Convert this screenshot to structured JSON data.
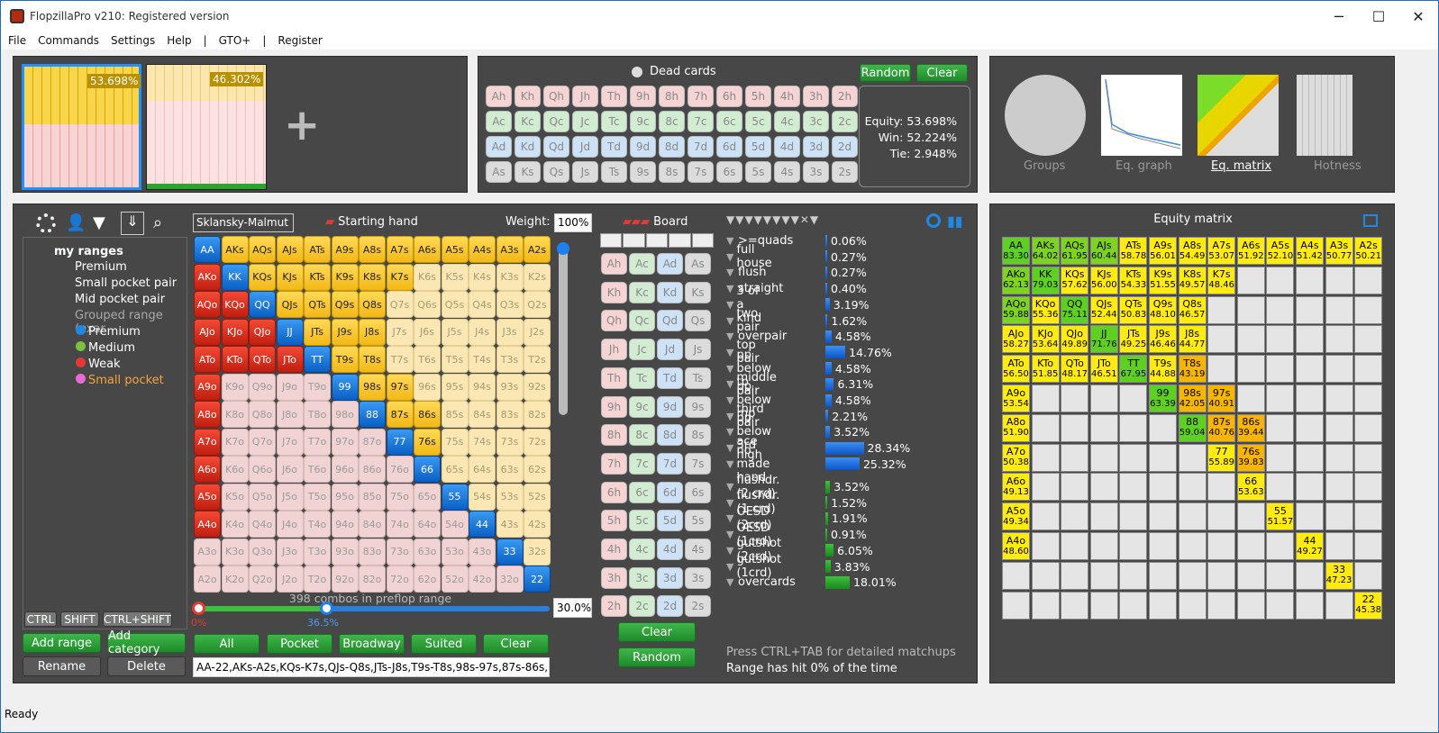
{
  "window": {
    "title": "FlopzillaPro v210: Registered version",
    "minimize": "─",
    "maximize": "☐",
    "close": "✕"
  },
  "menu": [
    "File",
    "Commands",
    "Settings",
    "Help",
    "|",
    "GTO+",
    "|",
    "Register"
  ],
  "ranges_top": {
    "pct1": "53.698%",
    "pct2": "46.302%",
    "add": "+"
  },
  "dead": {
    "title": "Dead cards",
    "random": "Random",
    "clear": "Clear",
    "rows": [
      [
        "Ah",
        "Kh",
        "Qh",
        "Jh",
        "Th",
        "9h",
        "8h",
        "7h",
        "6h",
        "5h",
        "4h",
        "3h",
        "2h"
      ],
      [
        "Ac",
        "Kc",
        "Qc",
        "Jc",
        "Tc",
        "9c",
        "8c",
        "7c",
        "6c",
        "5c",
        "4c",
        "3c",
        "2c"
      ],
      [
        "Ad",
        "Kd",
        "Qd",
        "Jd",
        "Td",
        "9d",
        "8d",
        "7d",
        "6d",
        "5d",
        "4d",
        "3d",
        "2d"
      ],
      [
        "As",
        "Ks",
        "Qs",
        "Js",
        "Ts",
        "9s",
        "8s",
        "7s",
        "6s",
        "5s",
        "4s",
        "3s",
        "2s"
      ]
    ],
    "equity": "Equity: 53.698%",
    "win": "Win: 52.224%",
    "tie": "Tie: 2.948%"
  },
  "tabs": [
    "Groups",
    "Eq. graph",
    "Eq. matrix",
    "Hotness"
  ],
  "tree": {
    "root": "my ranges",
    "items": [
      "Premium",
      "Small pocket pair",
      "Mid pocket pair"
    ],
    "group": "Grouped range (exar",
    "sub": [
      "Premium",
      "Medium",
      "Weak",
      "Small pocket"
    ],
    "sub_colors": [
      "#1e88e5",
      "#7bc142",
      "#e53935",
      "#e86ad7"
    ]
  },
  "modifiers": [
    "CTRL",
    "SHIFT",
    "CTRL+SHIFT"
  ],
  "left_buttons": [
    "Add range",
    "Add category",
    "Rename",
    "Delete"
  ],
  "grid": {
    "preset": "Sklansky-Malmut",
    "starting_hand": "Starting hand",
    "weight_label": "Weight:",
    "weight": "100%",
    "combos": "398 combos in preflop range",
    "pct": "30.0%",
    "slider_min": "0%",
    "slider_val": "36.5%",
    "rows": [
      [
        "AA",
        "AKs",
        "AQs",
        "AJs",
        "ATs",
        "A9s",
        "A8s",
        "A7s",
        "A6s",
        "A5s",
        "A4s",
        "A3s",
        "A2s"
      ],
      [
        "AKo",
        "KK",
        "KQs",
        "KJs",
        "KTs",
        "K9s",
        "K8s",
        "K7s",
        "K6s",
        "K5s",
        "K4s",
        "K3s",
        "K2s"
      ],
      [
        "AQo",
        "KQo",
        "QQ",
        "QJs",
        "QTs",
        "Q9s",
        "Q8s",
        "Q7s",
        "Q6s",
        "Q5s",
        "Q4s",
        "Q3s",
        "Q2s"
      ],
      [
        "AJo",
        "KJo",
        "QJo",
        "JJ",
        "JTs",
        "J9s",
        "J8s",
        "J7s",
        "J6s",
        "J5s",
        "J4s",
        "J3s",
        "J2s"
      ],
      [
        "ATo",
        "KTo",
        "QTo",
        "JTo",
        "TT",
        "T9s",
        "T8s",
        "T7s",
        "T6s",
        "T5s",
        "T4s",
        "T3s",
        "T2s"
      ],
      [
        "A9o",
        "K9o",
        "Q9o",
        "J9o",
        "T9o",
        "99",
        "98s",
        "97s",
        "96s",
        "95s",
        "94s",
        "93s",
        "92s"
      ],
      [
        "A8o",
        "K8o",
        "Q8o",
        "J8o",
        "T8o",
        "98o",
        "88",
        "87s",
        "86s",
        "85s",
        "84s",
        "83s",
        "82s"
      ],
      [
        "A7o",
        "K7o",
        "Q7o",
        "J7o",
        "T7o",
        "97o",
        "87o",
        "77",
        "76s",
        "75s",
        "74s",
        "73s",
        "72s"
      ],
      [
        "A6o",
        "K6o",
        "Q6o",
        "J6o",
        "T6o",
        "96o",
        "86o",
        "76o",
        "66",
        "65s",
        "64s",
        "63s",
        "62s"
      ],
      [
        "A5o",
        "K5o",
        "Q5o",
        "J5o",
        "T5o",
        "95o",
        "85o",
        "75o",
        "65o",
        "55",
        "54s",
        "53s",
        "52s"
      ],
      [
        "A4o",
        "K4o",
        "Q4o",
        "J4o",
        "T4o",
        "94o",
        "84o",
        "74o",
        "64o",
        "54o",
        "44",
        "43s",
        "42s"
      ],
      [
        "A3o",
        "K3o",
        "Q3o",
        "J3o",
        "T3o",
        "93o",
        "83o",
        "73o",
        "63o",
        "53o",
        "43o",
        "33",
        "32s"
      ],
      [
        "A2o",
        "K2o",
        "Q2o",
        "J2o",
        "T2o",
        "92o",
        "82o",
        "72o",
        "62o",
        "52o",
        "42o",
        "32o",
        "22"
      ]
    ],
    "buttons": [
      "All",
      "Pocket",
      "Broadway",
      "Suited",
      "Clear"
    ],
    "range_text": "AA-22,AKs-A2s,KQs-K7s,QJs-Q8s,JTs-J8s,T9s-T8s,98s-97s,87s-86s,"
  },
  "board": {
    "title": "Board",
    "cols": [
      [
        "Ah",
        "Kh",
        "Qh",
        "Jh",
        "Th",
        "9h",
        "8h",
        "7h",
        "6h",
        "5h",
        "4h",
        "3h",
        "2h"
      ],
      [
        "Ac",
        "Kc",
        "Qc",
        "Jc",
        "Tc",
        "9c",
        "8c",
        "7c",
        "6c",
        "5c",
        "4c",
        "3c",
        "2c"
      ],
      [
        "Ad",
        "Kd",
        "Qd",
        "Jd",
        "Td",
        "9d",
        "8d",
        "7d",
        "6d",
        "5d",
        "4d",
        "3d",
        "2d"
      ],
      [
        "As",
        "Ks",
        "Qs",
        "Js",
        "Ts",
        "9s",
        "8s",
        "7s",
        "6s",
        "5s",
        "4s",
        "3s",
        "2s"
      ]
    ],
    "clear": "Clear",
    "random": "Random"
  },
  "stats": [
    {
      "label": ">=quads",
      "value": "0.06%",
      "pct": 0.06
    },
    {
      "label": "full house",
      "value": "0.27%",
      "pct": 0.27
    },
    {
      "label": "flush",
      "value": "0.27%",
      "pct": 0.27
    },
    {
      "label": "straight",
      "value": "0.40%",
      "pct": 0.4
    },
    {
      "label": "3 of a kind",
      "value": "3.19%",
      "pct": 3.19
    },
    {
      "label": "two pair",
      "value": "1.62%",
      "pct": 1.62
    },
    {
      "label": "overpair",
      "value": "4.58%",
      "pct": 4.58
    },
    {
      "label": "top pair",
      "value": "14.76%",
      "pct": 14.76
    },
    {
      "label": "pp below tp",
      "value": "4.58%",
      "pct": 4.58
    },
    {
      "label": "middle pair",
      "value": "6.31%",
      "pct": 6.31
    },
    {
      "label": "pp below mp",
      "value": "4.58%",
      "pct": 4.58
    },
    {
      "label": "third pair",
      "value": "2.21%",
      "pct": 2.21
    },
    {
      "label": "pp below 3rd",
      "value": "3.52%",
      "pct": 3.52
    },
    {
      "label": "ace high",
      "value": "28.34%",
      "pct": 28.34
    },
    {
      "label": "no made hand",
      "value": "25.32%",
      "pct": 25.32
    }
  ],
  "draws": [
    {
      "label": "flushdr. (2 crd)",
      "value": "3.52%",
      "pct": 3.52
    },
    {
      "label": "flushdr. (1 crd)",
      "value": "1.52%",
      "pct": 1.52
    },
    {
      "label": "OESD (2crd)",
      "value": "1.91%",
      "pct": 1.91
    },
    {
      "label": "OESD (1crd)",
      "value": "0.91%",
      "pct": 0.91
    },
    {
      "label": "gutshot (2crd)",
      "value": "6.05%",
      "pct": 6.05
    },
    {
      "label": "gutshot (1crd)",
      "value": "3.83%",
      "pct": 3.83
    },
    {
      "label": "overcards",
      "value": "18.01%",
      "pct": 18.01
    }
  ],
  "stats_footer": {
    "hint": "Press CTRL+TAB for detailed matchups",
    "hit": "Range has hit 0% of the time"
  },
  "matrix": {
    "title": "Equity matrix",
    "rows": [
      [
        [
          "AA",
          "83.30"
        ],
        [
          "AKs",
          "64.02"
        ],
        [
          "AQs",
          "61.95"
        ],
        [
          "AJs",
          "60.44"
        ],
        [
          "ATs",
          "58.78"
        ],
        [
          "A9s",
          "56.01"
        ],
        [
          "A8s",
          "54.49"
        ],
        [
          "A7s",
          "53.07"
        ],
        [
          "A6s",
          "51.92"
        ],
        [
          "A5s",
          "52.10"
        ],
        [
          "A4s",
          "51.42"
        ],
        [
          "A3s",
          "50.77"
        ],
        [
          "A2s",
          "50.21"
        ]
      ],
      [
        [
          "AKo",
          "62.13"
        ],
        [
          "KK",
          "79.03"
        ],
        [
          "KQs",
          "57.62"
        ],
        [
          "KJs",
          "56.00"
        ],
        [
          "KTs",
          "54.33"
        ],
        [
          "K9s",
          "51.55"
        ],
        [
          "K8s",
          "49.57"
        ],
        [
          "K7s",
          "48.46"
        ],
        null,
        null,
        null,
        null,
        null
      ],
      [
        [
          "AQo",
          "59.88"
        ],
        [
          "KQo",
          "55.36"
        ],
        [
          "QQ",
          "75.11"
        ],
        [
          "QJs",
          "52.44"
        ],
        [
          "QTs",
          "50.83"
        ],
        [
          "Q9s",
          "48.10"
        ],
        [
          "Q8s",
          "46.57"
        ],
        null,
        null,
        null,
        null,
        null,
        null
      ],
      [
        [
          "AJo",
          "58.27"
        ],
        [
          "KJo",
          "53.64"
        ],
        [
          "QJo",
          "49.89"
        ],
        [
          "JJ",
          "71.76"
        ],
        [
          "JTs",
          "49.25"
        ],
        [
          "J9s",
          "46.46"
        ],
        [
          "J8s",
          "44.77"
        ],
        null,
        null,
        null,
        null,
        null,
        null
      ],
      [
        [
          "ATo",
          "56.50"
        ],
        [
          "KTo",
          "51.85"
        ],
        [
          "QTo",
          "48.17"
        ],
        [
          "JTo",
          "46.51"
        ],
        [
          "TT",
          "67.95"
        ],
        [
          "T9s",
          "44.88"
        ],
        [
          "T8s",
          "43.19"
        ],
        null,
        null,
        null,
        null,
        null,
        null
      ],
      [
        [
          "A9o",
          "53.54"
        ],
        null,
        null,
        null,
        null,
        [
          "99",
          "63.39"
        ],
        [
          "98s",
          "42.05"
        ],
        [
          "97s",
          "40.91"
        ],
        null,
        null,
        null,
        null,
        null
      ],
      [
        [
          "A8o",
          "51.90"
        ],
        null,
        null,
        null,
        null,
        null,
        [
          "88",
          "59.04"
        ],
        [
          "87s",
          "40.76"
        ],
        [
          "86s",
          "39.44"
        ],
        null,
        null,
        null,
        null
      ],
      [
        [
          "A7o",
          "50.38"
        ],
        null,
        null,
        null,
        null,
        null,
        null,
        [
          "77",
          "55.89"
        ],
        [
          "76s",
          "39.83"
        ],
        null,
        null,
        null,
        null
      ],
      [
        [
          "A6o",
          "49.13"
        ],
        null,
        null,
        null,
        null,
        null,
        null,
        null,
        [
          "66",
          "53.63"
        ],
        null,
        null,
        null,
        null
      ],
      [
        [
          "A5o",
          "49.34"
        ],
        null,
        null,
        null,
        null,
        null,
        null,
        null,
        null,
        [
          "55",
          "51.57"
        ],
        null,
        null,
        null
      ],
      [
        [
          "A4o",
          "48.60"
        ],
        null,
        null,
        null,
        null,
        null,
        null,
        null,
        null,
        null,
        [
          "44",
          "49.27"
        ],
        null,
        null
      ],
      [
        null,
        null,
        null,
        null,
        null,
        null,
        null,
        null,
        null,
        null,
        null,
        [
          "33",
          "47.23"
        ],
        null
      ],
      [
        null,
        null,
        null,
        null,
        null,
        null,
        null,
        null,
        null,
        null,
        null,
        null,
        [
          "22",
          "45.38"
        ]
      ]
    ]
  },
  "status": "Ready"
}
